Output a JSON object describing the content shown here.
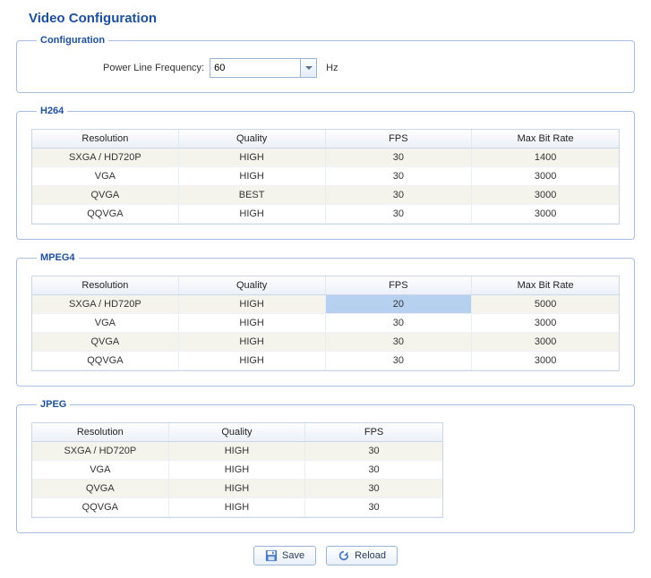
{
  "page_title": "Video Configuration",
  "configuration": {
    "legend": "Configuration",
    "power_line_label": "Power Line Frequency:",
    "power_line_value": "60",
    "power_line_unit": "Hz"
  },
  "h264": {
    "legend": "H264",
    "headers": [
      "Resolution",
      "Quality",
      "FPS",
      "Max Bit Rate"
    ],
    "rows": [
      {
        "resolution": "SXGA / HD720P",
        "quality": "HIGH",
        "fps": "30",
        "maxbitrate": "1400"
      },
      {
        "resolution": "VGA",
        "quality": "HIGH",
        "fps": "30",
        "maxbitrate": "3000"
      },
      {
        "resolution": "QVGA",
        "quality": "BEST",
        "fps": "30",
        "maxbitrate": "3000"
      },
      {
        "resolution": "QQVGA",
        "quality": "HIGH",
        "fps": "30",
        "maxbitrate": "3000"
      }
    ]
  },
  "mpeg4": {
    "legend": "MPEG4",
    "headers": [
      "Resolution",
      "Quality",
      "FPS",
      "Max Bit Rate"
    ],
    "rows": [
      {
        "resolution": "SXGA / HD720P",
        "quality": "HIGH",
        "fps": "20",
        "maxbitrate": "5000",
        "selected_col": "fps"
      },
      {
        "resolution": "VGA",
        "quality": "HIGH",
        "fps": "30",
        "maxbitrate": "3000"
      },
      {
        "resolution": "QVGA",
        "quality": "HIGH",
        "fps": "30",
        "maxbitrate": "3000"
      },
      {
        "resolution": "QQVGA",
        "quality": "HIGH",
        "fps": "30",
        "maxbitrate": "3000"
      }
    ]
  },
  "jpeg": {
    "legend": "JPEG",
    "headers": [
      "Resolution",
      "Quality",
      "FPS"
    ],
    "rows": [
      {
        "resolution": "SXGA / HD720P",
        "quality": "HIGH",
        "fps": "30"
      },
      {
        "resolution": "VGA",
        "quality": "HIGH",
        "fps": "30"
      },
      {
        "resolution": "QVGA",
        "quality": "HIGH",
        "fps": "30"
      },
      {
        "resolution": "QQVGA",
        "quality": "HIGH",
        "fps": "30"
      }
    ]
  },
  "buttons": {
    "save": "Save",
    "reload": "Reload"
  }
}
